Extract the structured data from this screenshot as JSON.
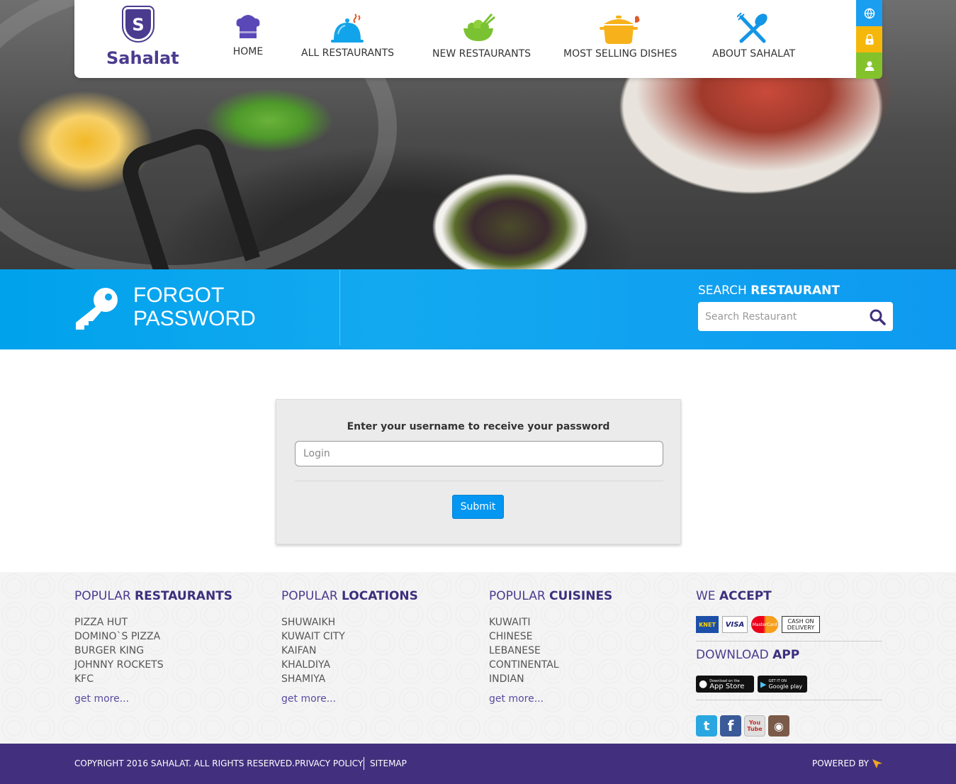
{
  "brand": {
    "name": "Sahalat",
    "logo_letter": "S",
    "color": "#4b3b8f"
  },
  "nav": {
    "items": [
      {
        "label": "HOME",
        "icon": "chef-hat-icon",
        "color": "#5b48b8"
      },
      {
        "label": "ALL RESTAURANTS",
        "icon": "food-cloche-icon",
        "color": "#12a4ea"
      },
      {
        "label": "NEW RESTAURANTS",
        "icon": "salad-bowl-icon",
        "color": "#7ac232"
      },
      {
        "label": "MOST SELLING DISHES",
        "icon": "cooking-pot-icon",
        "color": "#f7b21b"
      },
      {
        "label": "ABOUT SAHALAT",
        "icon": "fork-spoon-icon",
        "color": "#1496e6"
      }
    ],
    "side_buttons": [
      {
        "icon": "globe-icon",
        "color": "#1a9ef0"
      },
      {
        "icon": "lock-icon",
        "color": "#f6b70d"
      },
      {
        "icon": "user-icon",
        "color": "#83c22b"
      }
    ]
  },
  "band": {
    "title_line1": "FORGOT",
    "title_line2": "PASSWORD",
    "search_title_plain": "SEARCH",
    "search_title_bold": "RESTAURANT",
    "search_placeholder": "Search Restaurant"
  },
  "form": {
    "title": "Enter your username to receive your password",
    "login_placeholder": "Login",
    "submit_label": "Submit"
  },
  "footer": {
    "restaurants": {
      "title_plain": "POPULAR",
      "title_bold": "RESTAURANTS",
      "items": [
        "PIZZA HUT",
        "DOMINO`S PIZZA",
        "BURGER KING",
        "JOHNNY ROCKETS",
        "KFC"
      ],
      "more": "get more..."
    },
    "locations": {
      "title_plain": "POPULAR",
      "title_bold": "LOCATIONS",
      "items": [
        "SHUWAIKH",
        "KUWAIT CITY",
        "KAIFAN",
        "KHALDIYA",
        "SHAMIYA"
      ],
      "more": "get more..."
    },
    "cuisines": {
      "title_plain": "POPULAR",
      "title_bold": "CUISINES",
      "items": [
        "KUWAITI",
        "CHINESE",
        "LEBANESE",
        "CONTINENTAL",
        "INDIAN"
      ],
      "more": "get more..."
    },
    "accept": {
      "title_plain": "WE",
      "title_bold": "ACCEPT",
      "cards": [
        "KNET",
        "VISA",
        "MasterCard",
        "CASH ON DELIVERY"
      ]
    },
    "app": {
      "title_plain": "DOWNLOAD",
      "title_bold": "APP",
      "appstore_small": "Download on the",
      "appstore_big": "App Store",
      "googleplay_small": "GET IT ON",
      "googleplay_big": "Google play"
    },
    "social": [
      {
        "icon": "twitter-icon",
        "glyph": "t",
        "color": "#2aa7e0"
      },
      {
        "icon": "facebook-icon",
        "glyph": "f",
        "color": "#3a5a98"
      },
      {
        "icon": "youtube-icon",
        "glyph": "You Tube",
        "color": "#e0e0e0"
      },
      {
        "icon": "instagram-icon",
        "glyph": "◉",
        "color": "#7a5a48"
      }
    ]
  },
  "bottom": {
    "copyright": "COPYRIGHT 2016 SAHALAT. ALL RIGHTS RESERVED.",
    "privacy": "PRIVACY POLICY",
    "sitemap": "SITEMAP",
    "powered_by": "POWERED BY"
  }
}
